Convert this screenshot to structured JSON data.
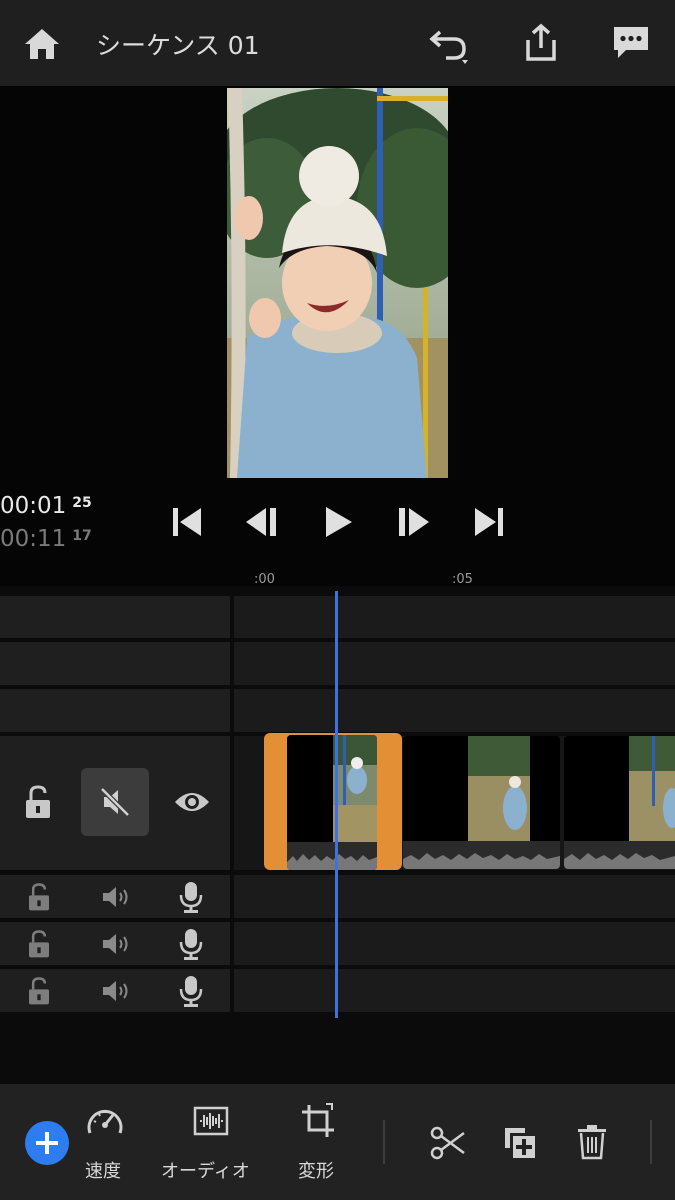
{
  "header": {
    "title": "シーケンス 01",
    "icons": [
      "home-icon",
      "undo-icon",
      "share-icon",
      "comment-icon"
    ]
  },
  "playback": {
    "current_time": "00:01",
    "current_frame": "25",
    "total_time": "00:11",
    "total_frame": "17",
    "controls": [
      "skip-to-start-icon",
      "step-back-icon",
      "play-icon",
      "step-forward-icon",
      "skip-to-end-icon"
    ]
  },
  "ruler": {
    "mark_0": ":00",
    "mark_1": ":05"
  },
  "tracks": {
    "video_track_controls": [
      "unlock-icon",
      "mute-icon",
      "visibility-icon"
    ],
    "audio_track_controls": [
      "unlock-icon",
      "speaker-icon",
      "microphone-icon"
    ]
  },
  "toolbar": {
    "speed_label": "速度",
    "audio_label": "オーディオ",
    "transform_label": "変形",
    "icons": [
      "add-icon",
      "speed-icon",
      "audio-waveform-icon",
      "crop-icon",
      "scissors-icon",
      "duplicate-icon",
      "trash-icon"
    ]
  },
  "colors": {
    "accent_blue": "#3d73e0",
    "selection_orange": "#e38f35",
    "add_button": "#2d7cf0"
  }
}
